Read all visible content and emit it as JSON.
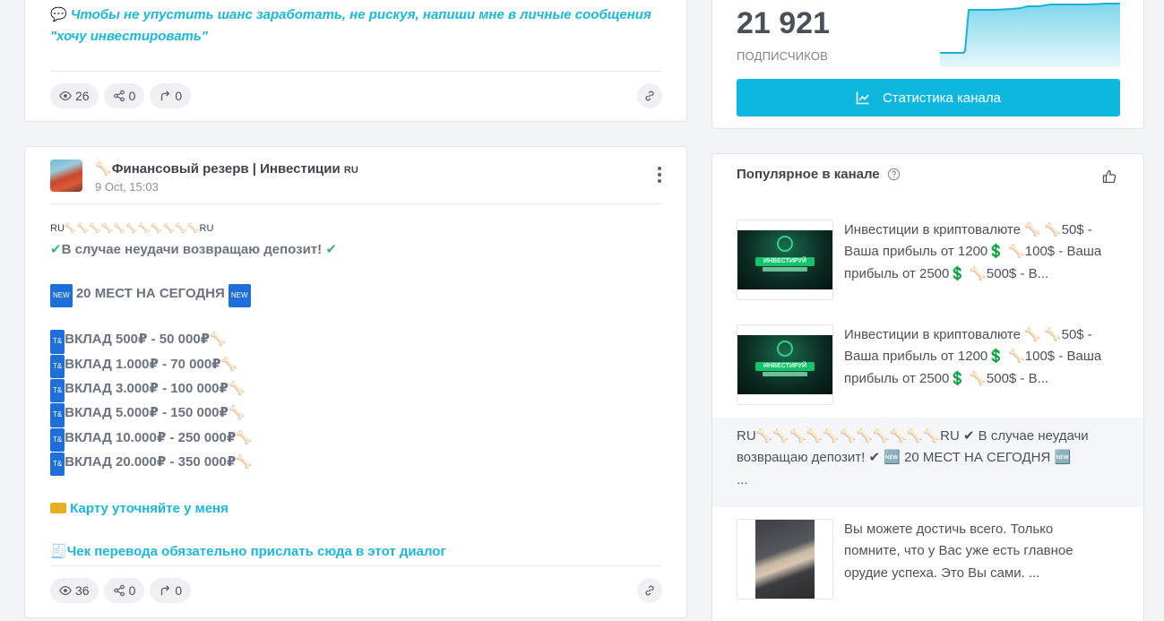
{
  "post_top": {
    "text_line1": "Чтобы не упустить шанс заработать, не рискуя, напиши мне в личные сообщения",
    "text_line2": "\"хочу инвестировать\"",
    "emoji": "💬",
    "views": "26",
    "shares": "0",
    "forwards": "0"
  },
  "post_main": {
    "channel_name": "Финансовый резерв | Инвестиции",
    "channel_flag": "RU",
    "date": "9 Oct, 15:03",
    "lines": {
      "flags_row": "RU🦴🦴🦴🦴🦴🦴🦴🦴🦴🦴🦴RU",
      "refund": "В случае неудачи возвращаю депозит!",
      "places": "20 МЕСТ НА СЕГОДНЯ",
      "deposit1": "ВКЛАД 500₽ - 50 000₽",
      "deposit2": "ВКЛАД 1.000₽ - 70 000₽",
      "deposit3": "ВКЛАД 3.000₽ - 100 000₽",
      "deposit4": "ВКЛАД 5.000₽ - 150 000₽",
      "deposit5": "ВКЛАД 10.000₽ - 250 000₽",
      "deposit6": "ВКЛАД 20.000₽ - 350 000₽",
      "card": "Карту уточняйте у меня",
      "receipt": "Чек перевода обязательно прислать сюда в этот диалог"
    },
    "views": "36",
    "shares": "0",
    "forwards": "0"
  },
  "channel_stats": {
    "subscribers": "21 921",
    "subscribers_label": "ПОДПИСЧИКОВ",
    "stats_button": "Статистика канала"
  },
  "popular": {
    "title": "Популярное в канале",
    "item1_line1": "Инвестиции в криптовалюте 🦴 🦴50$ -",
    "item1_line2": "Ваша прибыль от 1200💲 🦴100$ - Ваша",
    "item1_line3": "прибыль от 2500💲 🦴500$ - В...",
    "item2_line1": "Инвестиции в криптовалюте 🦴 🦴50$ -",
    "item2_line2": "Ваша прибыль от 1200💲 🦴100$ - Ваша",
    "item2_line3": "прибыль от 2500💲 🦴500$ - В...",
    "item3_line1": "RU🦴🦴🦴🦴🦴🦴🦴🦴🦴🦴🦴RU ✔ В случае неудачи",
    "item3_line2": "возвращаю депозит! ✔ 🆕 20 МЕСТ НА СЕГОДНЯ 🆕",
    "item3_line3": "...",
    "item4_line1": "Вы можете достичь всего. Только",
    "item4_line2": "помните, что у Вас уже есть главное",
    "item4_line3": "орудие успеха. Это Вы сами. ...",
    "thumb_caption": "ИНВЕСТИРУЙ"
  },
  "colors": {
    "accent": "#0eb7dd",
    "link": "#1ab8db",
    "check": "#3cb371"
  }
}
